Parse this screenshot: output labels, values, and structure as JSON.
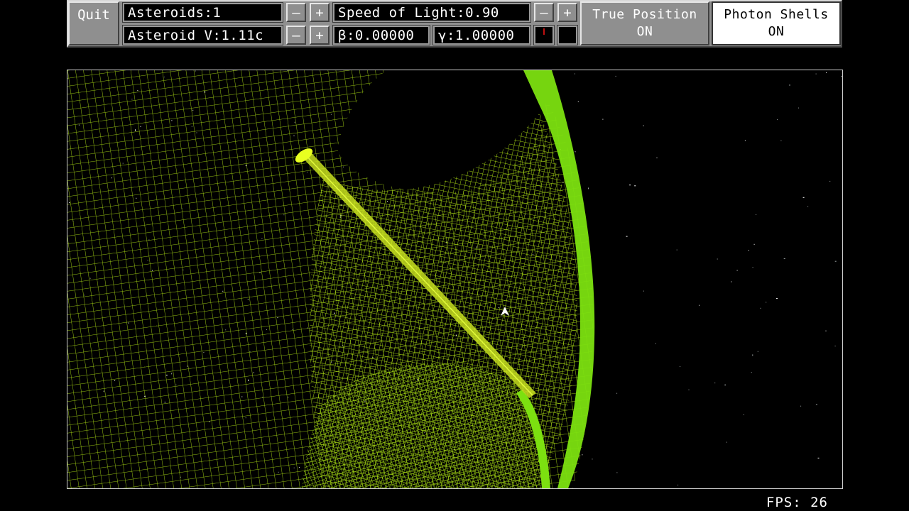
{
  "toolbar": {
    "quit_label": "Quit",
    "asteroids_text": "Asteroids:1",
    "asteroid_velocity_text": "Asteroid V:1.11c",
    "speed_of_light_text": "Speed of Light:0.90",
    "beta_text": "β:0.00000",
    "gamma_text": "γ:1.00000",
    "minus_glyph": "–",
    "plus_glyph": "+",
    "true_position_label": "True Position",
    "true_position_state": "ON",
    "photon_shells_label": "Photon Shells",
    "photon_shells_state": "ON"
  },
  "status": {
    "fps_text": "FPS: 26"
  },
  "colors": {
    "mesh": "#a8d814",
    "mesh_bright": "#7ce010",
    "asteroid": "#e8ff20",
    "ship": "#ffffff",
    "panel": "#8f8f8f"
  },
  "icons": {
    "ship": "ship-triangle-icon",
    "asteroid": "asteroid-icon"
  }
}
